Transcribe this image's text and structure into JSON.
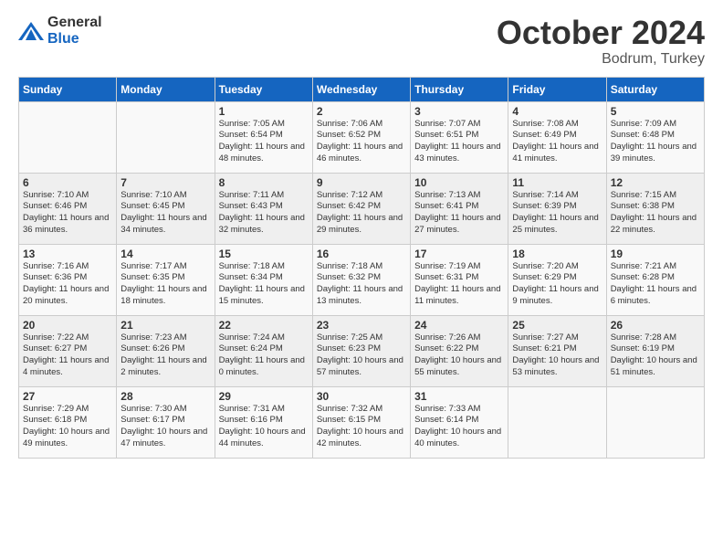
{
  "header": {
    "logo_general": "General",
    "logo_blue": "Blue",
    "month": "October 2024",
    "location": "Bodrum, Turkey"
  },
  "days_of_week": [
    "Sunday",
    "Monday",
    "Tuesday",
    "Wednesday",
    "Thursday",
    "Friday",
    "Saturday"
  ],
  "weeks": [
    [
      {
        "day": "",
        "content": ""
      },
      {
        "day": "",
        "content": ""
      },
      {
        "day": "1",
        "content": "Sunrise: 7:05 AM\nSunset: 6:54 PM\nDaylight: 11 hours and 48 minutes."
      },
      {
        "day": "2",
        "content": "Sunrise: 7:06 AM\nSunset: 6:52 PM\nDaylight: 11 hours and 46 minutes."
      },
      {
        "day": "3",
        "content": "Sunrise: 7:07 AM\nSunset: 6:51 PM\nDaylight: 11 hours and 43 minutes."
      },
      {
        "day": "4",
        "content": "Sunrise: 7:08 AM\nSunset: 6:49 PM\nDaylight: 11 hours and 41 minutes."
      },
      {
        "day": "5",
        "content": "Sunrise: 7:09 AM\nSunset: 6:48 PM\nDaylight: 11 hours and 39 minutes."
      }
    ],
    [
      {
        "day": "6",
        "content": "Sunrise: 7:10 AM\nSunset: 6:46 PM\nDaylight: 11 hours and 36 minutes."
      },
      {
        "day": "7",
        "content": "Sunrise: 7:10 AM\nSunset: 6:45 PM\nDaylight: 11 hours and 34 minutes."
      },
      {
        "day": "8",
        "content": "Sunrise: 7:11 AM\nSunset: 6:43 PM\nDaylight: 11 hours and 32 minutes."
      },
      {
        "day": "9",
        "content": "Sunrise: 7:12 AM\nSunset: 6:42 PM\nDaylight: 11 hours and 29 minutes."
      },
      {
        "day": "10",
        "content": "Sunrise: 7:13 AM\nSunset: 6:41 PM\nDaylight: 11 hours and 27 minutes."
      },
      {
        "day": "11",
        "content": "Sunrise: 7:14 AM\nSunset: 6:39 PM\nDaylight: 11 hours and 25 minutes."
      },
      {
        "day": "12",
        "content": "Sunrise: 7:15 AM\nSunset: 6:38 PM\nDaylight: 11 hours and 22 minutes."
      }
    ],
    [
      {
        "day": "13",
        "content": "Sunrise: 7:16 AM\nSunset: 6:36 PM\nDaylight: 11 hours and 20 minutes."
      },
      {
        "day": "14",
        "content": "Sunrise: 7:17 AM\nSunset: 6:35 PM\nDaylight: 11 hours and 18 minutes."
      },
      {
        "day": "15",
        "content": "Sunrise: 7:18 AM\nSunset: 6:34 PM\nDaylight: 11 hours and 15 minutes."
      },
      {
        "day": "16",
        "content": "Sunrise: 7:18 AM\nSunset: 6:32 PM\nDaylight: 11 hours and 13 minutes."
      },
      {
        "day": "17",
        "content": "Sunrise: 7:19 AM\nSunset: 6:31 PM\nDaylight: 11 hours and 11 minutes."
      },
      {
        "day": "18",
        "content": "Sunrise: 7:20 AM\nSunset: 6:29 PM\nDaylight: 11 hours and 9 minutes."
      },
      {
        "day": "19",
        "content": "Sunrise: 7:21 AM\nSunset: 6:28 PM\nDaylight: 11 hours and 6 minutes."
      }
    ],
    [
      {
        "day": "20",
        "content": "Sunrise: 7:22 AM\nSunset: 6:27 PM\nDaylight: 11 hours and 4 minutes."
      },
      {
        "day": "21",
        "content": "Sunrise: 7:23 AM\nSunset: 6:26 PM\nDaylight: 11 hours and 2 minutes."
      },
      {
        "day": "22",
        "content": "Sunrise: 7:24 AM\nSunset: 6:24 PM\nDaylight: 11 hours and 0 minutes."
      },
      {
        "day": "23",
        "content": "Sunrise: 7:25 AM\nSunset: 6:23 PM\nDaylight: 10 hours and 57 minutes."
      },
      {
        "day": "24",
        "content": "Sunrise: 7:26 AM\nSunset: 6:22 PM\nDaylight: 10 hours and 55 minutes."
      },
      {
        "day": "25",
        "content": "Sunrise: 7:27 AM\nSunset: 6:21 PM\nDaylight: 10 hours and 53 minutes."
      },
      {
        "day": "26",
        "content": "Sunrise: 7:28 AM\nSunset: 6:19 PM\nDaylight: 10 hours and 51 minutes."
      }
    ],
    [
      {
        "day": "27",
        "content": "Sunrise: 7:29 AM\nSunset: 6:18 PM\nDaylight: 10 hours and 49 minutes."
      },
      {
        "day": "28",
        "content": "Sunrise: 7:30 AM\nSunset: 6:17 PM\nDaylight: 10 hours and 47 minutes."
      },
      {
        "day": "29",
        "content": "Sunrise: 7:31 AM\nSunset: 6:16 PM\nDaylight: 10 hours and 44 minutes."
      },
      {
        "day": "30",
        "content": "Sunrise: 7:32 AM\nSunset: 6:15 PM\nDaylight: 10 hours and 42 minutes."
      },
      {
        "day": "31",
        "content": "Sunrise: 7:33 AM\nSunset: 6:14 PM\nDaylight: 10 hours and 40 minutes."
      },
      {
        "day": "",
        "content": ""
      },
      {
        "day": "",
        "content": ""
      }
    ]
  ]
}
